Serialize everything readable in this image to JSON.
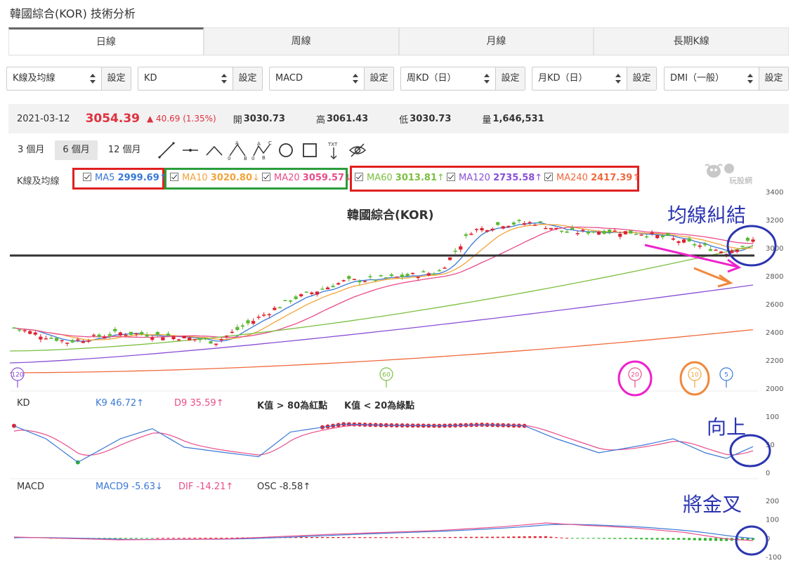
{
  "page": {
    "title": "韓國綜合(KOR) 技術分析"
  },
  "tabs": [
    {
      "label": "日線",
      "active": true
    },
    {
      "label": "周線",
      "active": false
    },
    {
      "label": "月線",
      "active": false
    },
    {
      "label": "長期K線",
      "active": false
    }
  ],
  "selectors": [
    {
      "value": "K線及均線",
      "button": "設定"
    },
    {
      "value": "KD",
      "button": "設定"
    },
    {
      "value": "MACD",
      "button": "設定"
    },
    {
      "value": "周KD（日）",
      "button": "設定"
    },
    {
      "value": "月KD（日）",
      "button": "設定"
    },
    {
      "value": "DMI（一般）",
      "button": "設定"
    }
  ],
  "quote": {
    "date": "2021-03-12",
    "price": "3054.39",
    "change": "▲ 40.69 (1.35%)",
    "open_label": "開",
    "open": "3030.73",
    "high_label": "高",
    "high": "3061.43",
    "low_label": "低",
    "low": "3030.73",
    "volume_label": "量",
    "volume": "1,646,531"
  },
  "ranges": [
    {
      "label": "3 個月",
      "active": false
    },
    {
      "label": "6 個月",
      "active": true
    },
    {
      "label": "12 個月",
      "active": false
    }
  ],
  "tools": [
    "line-tool-icon",
    "horizontal-line-icon",
    "angle-line-icon",
    "abc-pattern-icon",
    "abcd-pattern-icon",
    "circle-tool-icon",
    "rectangle-tool-icon",
    "text-tool-icon",
    "hide-eye-icon"
  ],
  "tool_text": {
    "a1": "A",
    "o1": "0",
    "b1": "B",
    "a2": "A",
    "c2": "C",
    "o2": "0",
    "b2": "B",
    "txt": "TXT"
  },
  "ma": {
    "title": "K線及均線",
    "items": [
      {
        "name": "MA5",
        "value": "2999.69",
        "arrow": "↑",
        "color": "#3a78d6"
      },
      {
        "name": "MA10",
        "value": "3020.80",
        "arrow": "↓",
        "color": "#f2a33a"
      },
      {
        "name": "MA20",
        "value": "3059.57",
        "arrow": "↓",
        "color": "#e84d8a"
      },
      {
        "name": "MA60",
        "value": "3013.81",
        "arrow": "↑",
        "color": "#7cbf3f"
      },
      {
        "name": "MA120",
        "value": "2735.58",
        "arrow": "↑",
        "color": "#8a4fd6"
      },
      {
        "name": "MA240",
        "value": "2417.39",
        "arrow": "↑",
        "color": "#f06a3c"
      }
    ],
    "box_colors": {
      "red": "#e02020",
      "green": "#2a9d3a"
    }
  },
  "logo_text": "玩股網",
  "chart_data": {
    "type": "candlestick",
    "title": "韓國綜合(KOR)",
    "price_axis": [
      "3400",
      "3200",
      "3000",
      "2800",
      "2600",
      "2400",
      "2200",
      "2000"
    ],
    "reference_line": 2935,
    "ma_markers": [
      {
        "label": "120",
        "color": "#8a4fd6"
      },
      {
        "label": "60",
        "color": "#7cbf3f"
      },
      {
        "label": "20",
        "color": "#e84d8a"
      },
      {
        "label": "10",
        "color": "#f2a33a"
      },
      {
        "label": "5",
        "color": "#3a78d6"
      }
    ],
    "kd": {
      "label": "KD",
      "k_text": "K9 46.72↑",
      "d_text": "D9 35.59↑",
      "note1": "K值 > 80為紅點",
      "note2": "K值 < 20為綠點",
      "axis": [
        "100",
        "50",
        "0"
      ]
    },
    "macd": {
      "label": "MACD",
      "macd_text": "MACD9 -5.63↓",
      "dif_text": "DIF -14.21↑",
      "osc_text": "OSC -8.58↑",
      "axis": [
        "200",
        "100",
        "0",
        "-100"
      ]
    }
  },
  "annotations": {
    "ma_tangle": "均線糾結",
    "upward": "向上",
    "golden_cross": "將金叉"
  }
}
